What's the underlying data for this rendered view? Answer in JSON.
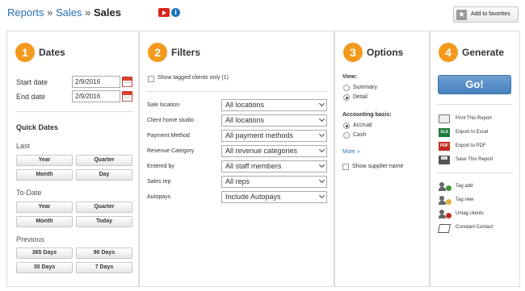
{
  "breadcrumb": {
    "reports": "Reports",
    "sales_link": "Sales",
    "sep1": " » ",
    "sep2": " » ",
    "current": "Sales"
  },
  "topbar": {
    "favorites_label": "Add to favorites",
    "video_icon": "youtube-icon",
    "info_icon": "info-icon",
    "star_icon": "star-icon"
  },
  "colors": {
    "step_badge": "#f39a1e",
    "link": "#2a6fb5",
    "go_button": "#4f86c0"
  },
  "dates": {
    "step": "1",
    "title": "Dates",
    "start_label": "Start date",
    "start_value": "2/9/2016",
    "end_label": "End date",
    "end_value": "2/9/2016",
    "quick_title": "Quick Dates",
    "last_label": "Last",
    "last_buttons": [
      "Year",
      "Quarter",
      "Month",
      "Day"
    ],
    "todate_label": "To-Date",
    "todate_buttons": [
      "Year",
      "Quarter",
      "Month",
      "Today"
    ],
    "previous_label": "Previous",
    "previous_buttons": [
      "365 Days",
      "90 Days",
      "30 Days",
      "7 Days"
    ]
  },
  "filters": {
    "step": "2",
    "title": "Filters",
    "tagged_label": "Show tagged clients only (1)",
    "rows": [
      {
        "label": "Sale location",
        "value": "All locations"
      },
      {
        "label": "Client home studio",
        "value": "All locations"
      },
      {
        "label": "Payment Method",
        "value": "All payment methods"
      },
      {
        "label": "Revenue Category",
        "value": "All revenue categories"
      },
      {
        "label": "Entered by",
        "value": "All staff members"
      },
      {
        "label": "Sales rep",
        "value": "All reps"
      },
      {
        "label": "Autopays",
        "value": "Include Autopays"
      }
    ]
  },
  "options": {
    "step": "3",
    "title": "Options",
    "view_label": "View:",
    "view_summary": "Summary",
    "view_detail": "Detail",
    "view_selected": "Detail",
    "basis_label": "Accounting basis:",
    "basis_accrual": "Accrual",
    "basis_cash": "Cash",
    "basis_selected": "Accrual",
    "more_link": "More »",
    "supplier_label": "Show supplier name"
  },
  "generate": {
    "step": "4",
    "title": "Generate",
    "go_label": "Go!",
    "actions": [
      "Print This Report",
      "Export to Excel",
      "Export to PDF",
      "Save This Report"
    ],
    "xls_text": "XLS",
    "pdf_text": "PDF",
    "tag_actions": [
      "Tag add",
      "Tag new",
      "Untag clients",
      "Constant Contact"
    ]
  }
}
